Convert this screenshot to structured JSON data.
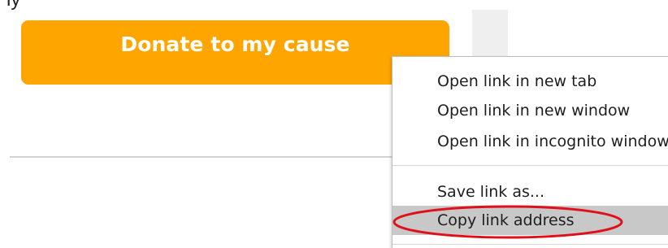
{
  "page": {
    "top_fragment": "ly"
  },
  "donate_button": {
    "label": "Donate to my cause",
    "color": "#ffa500"
  },
  "context_menu": {
    "items": [
      {
        "label": "Open link in new tab"
      },
      {
        "label": "Open link in new window"
      },
      {
        "label": "Open link in incognito window"
      },
      {
        "label": "Save link as..."
      },
      {
        "label": "Copy link address",
        "highlighted": true
      }
    ],
    "highlight_color": "#c8c8c8"
  },
  "annotation": {
    "shape": "ellipse",
    "color": "#e0101a",
    "target": "Copy link address"
  }
}
